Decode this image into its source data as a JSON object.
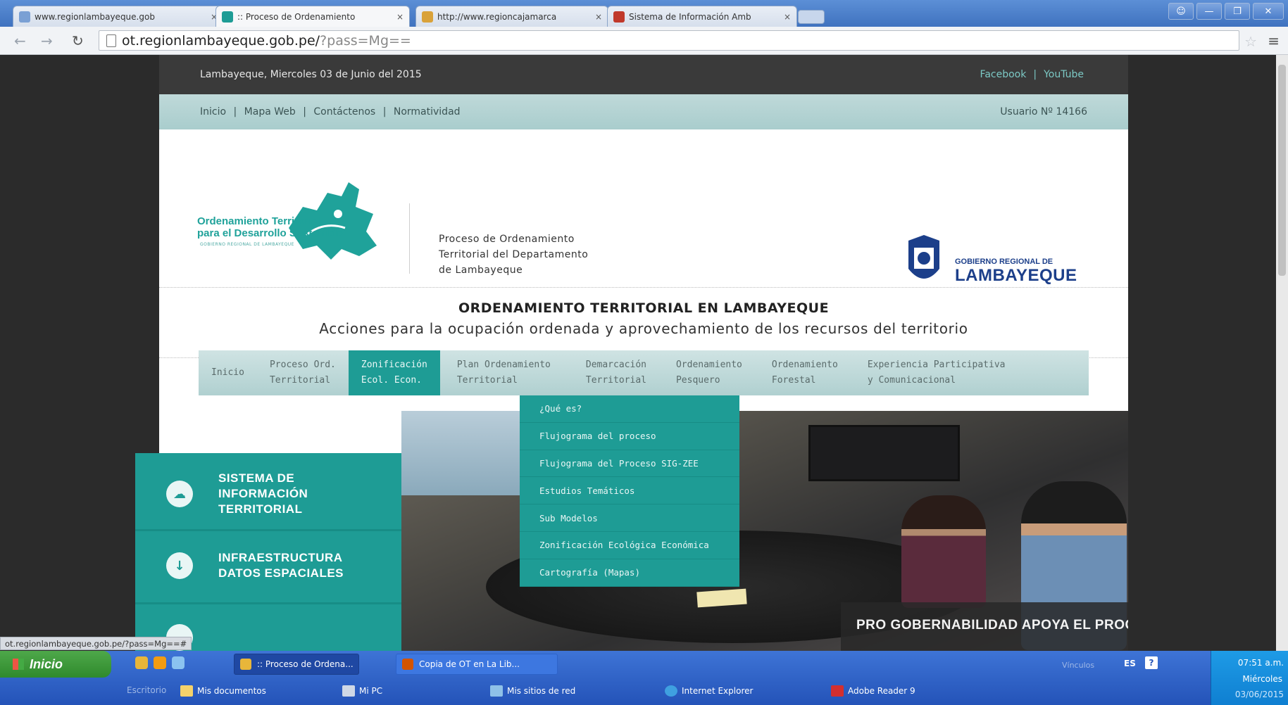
{
  "browser": {
    "tabs": [
      {
        "title": "www.regionlambayeque.gob",
        "favicon_color": "#7aa0d4"
      },
      {
        "title": ":: Proceso de Ordenamiento",
        "favicon_color": "#1e9c95"
      },
      {
        "title": "http://www.regioncajamarca",
        "favicon_color": "#d9a23a"
      },
      {
        "title": "Sistema de Información Amb",
        "favicon_color": "#c0392b"
      }
    ],
    "tab_close": "×",
    "url_host": "ot.regionlambayeque.gob.pe/",
    "url_rest": "?pass=Mg=="
  },
  "site": {
    "date_line": "Lambayeque, Miercoles 03 de Junio del 2015",
    "social": [
      "Facebook",
      "YouTube"
    ],
    "social_sep": "|",
    "top_links": [
      "Inicio",
      "Mapa Web",
      "Contáctenos",
      "Normatividad"
    ],
    "top_links_sep": "|",
    "user_counter": "Usuario Nº 14166",
    "logo_ot": {
      "line1": "Ordenamiento Territorial",
      "line2": "para el Desarrollo Sostenible",
      "line3": "GOBIERNO REGIONAL DE LAMBAYEQUE"
    },
    "process_text": [
      "Proceso de Ordenamiento",
      "Territorial del Departamento",
      "de Lambayeque"
    ],
    "gobierno": {
      "line1": "GOBIERNO REGIONAL DE",
      "line2": "LAMBAYEQUE"
    },
    "headline": "ORDENAMIENTO TERRITORIAL EN LAMBAYEQUE",
    "subheadline": "Acciones para la ocupación ordenada y aprovechamiento de los recursos del territorio",
    "main_nav": [
      {
        "l1": "Inicio",
        "l2": ""
      },
      {
        "l1": "Proceso Ord.",
        "l2": "Territorial"
      },
      {
        "l1": "Zonificación",
        "l2": "Ecol. Econ."
      },
      {
        "l1": "Plan Ordenamiento",
        "l2": "Territorial"
      },
      {
        "l1": "Demarcación",
        "l2": "Territorial"
      },
      {
        "l1": "Ordenamiento",
        "l2": "Pesquero"
      },
      {
        "l1": "Ordenamiento",
        "l2": "Forestal"
      },
      {
        "l1": "Experiencia Participativa",
        "l2": "y Comunicacional"
      }
    ],
    "dropdown": [
      "¿Qué es?",
      "Flujograma del proceso",
      "Flujograma del Proceso SIG-ZEE",
      "Estudios Temáticos",
      "Sub Modelos",
      "Zonificación Ecológica Económica",
      "Cartografía (Mapas)"
    ],
    "sit_panel": {
      "item1": [
        "SISTEMA DE",
        "INFORMACIÓN",
        "TERRITORIAL"
      ],
      "item2": [
        "INFRAESTRUCTURA",
        "DATOS ESPACIALES"
      ]
    },
    "slide_caption": "PRO GOBERNABILIDAD APOYA EL PROCESO"
  },
  "status_url": "ot.regionlambayeque.gob.pe/?pass=Mg==#",
  "taskbar": {
    "start_label": "Inicio",
    "task_buttons": [
      ":: Proceso de Ordena...",
      "Copia de OT en La Lib..."
    ],
    "row2_label": "Escritorio",
    "row2_items": [
      "Mis documentos",
      "Mi PC",
      "Mis sitios de red",
      "Internet Explorer",
      "Adobe Reader 9"
    ],
    "vinculos": "Vínculos",
    "lang": "ES",
    "help": "?",
    "time": "07:51 a.m.",
    "day": "Miércoles",
    "date": "03/06/2015"
  },
  "colors": {
    "teal": "#1e9c95",
    "navy": "#1c3f8a",
    "xp_blue": "#2453b8"
  }
}
